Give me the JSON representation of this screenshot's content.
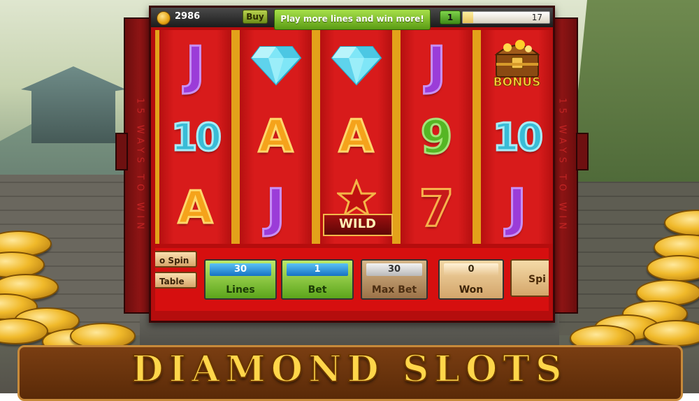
{
  "top_bar": {
    "balance": "2986",
    "buy_label": "Buy",
    "promo_text": "Play more lines and win more!",
    "level": "1",
    "xp_value": "17",
    "xp_progress": 0.12
  },
  "side_banner": {
    "text": "15 WAYS TO WIN"
  },
  "reels": [
    [
      "J",
      "10",
      "A"
    ],
    [
      "diamond",
      "A",
      "J"
    ],
    [
      "diamond",
      "A",
      "wild"
    ],
    [
      "J",
      "9",
      "7"
    ],
    [
      "bonus",
      "10",
      "J"
    ]
  ],
  "symbol_labels": {
    "wild": "WILD",
    "bonus": "BONUS"
  },
  "controls": {
    "auto_spin_label": "o Spin",
    "pay_table_label": "Table",
    "lines": {
      "value": "30",
      "label": "Lines"
    },
    "bet": {
      "value": "1",
      "label": "Bet"
    },
    "max_bet": {
      "value": "30",
      "label": "Max Bet"
    },
    "won": {
      "value": "0",
      "label": "Won"
    },
    "spin_label": "Spi"
  },
  "title": "DIAMOND SLOTS",
  "colors": {
    "frame_red": "#b50d0d",
    "panel_red": "#d60f0f",
    "gold": "#ffd64a",
    "green_button": "#5ba51b"
  }
}
